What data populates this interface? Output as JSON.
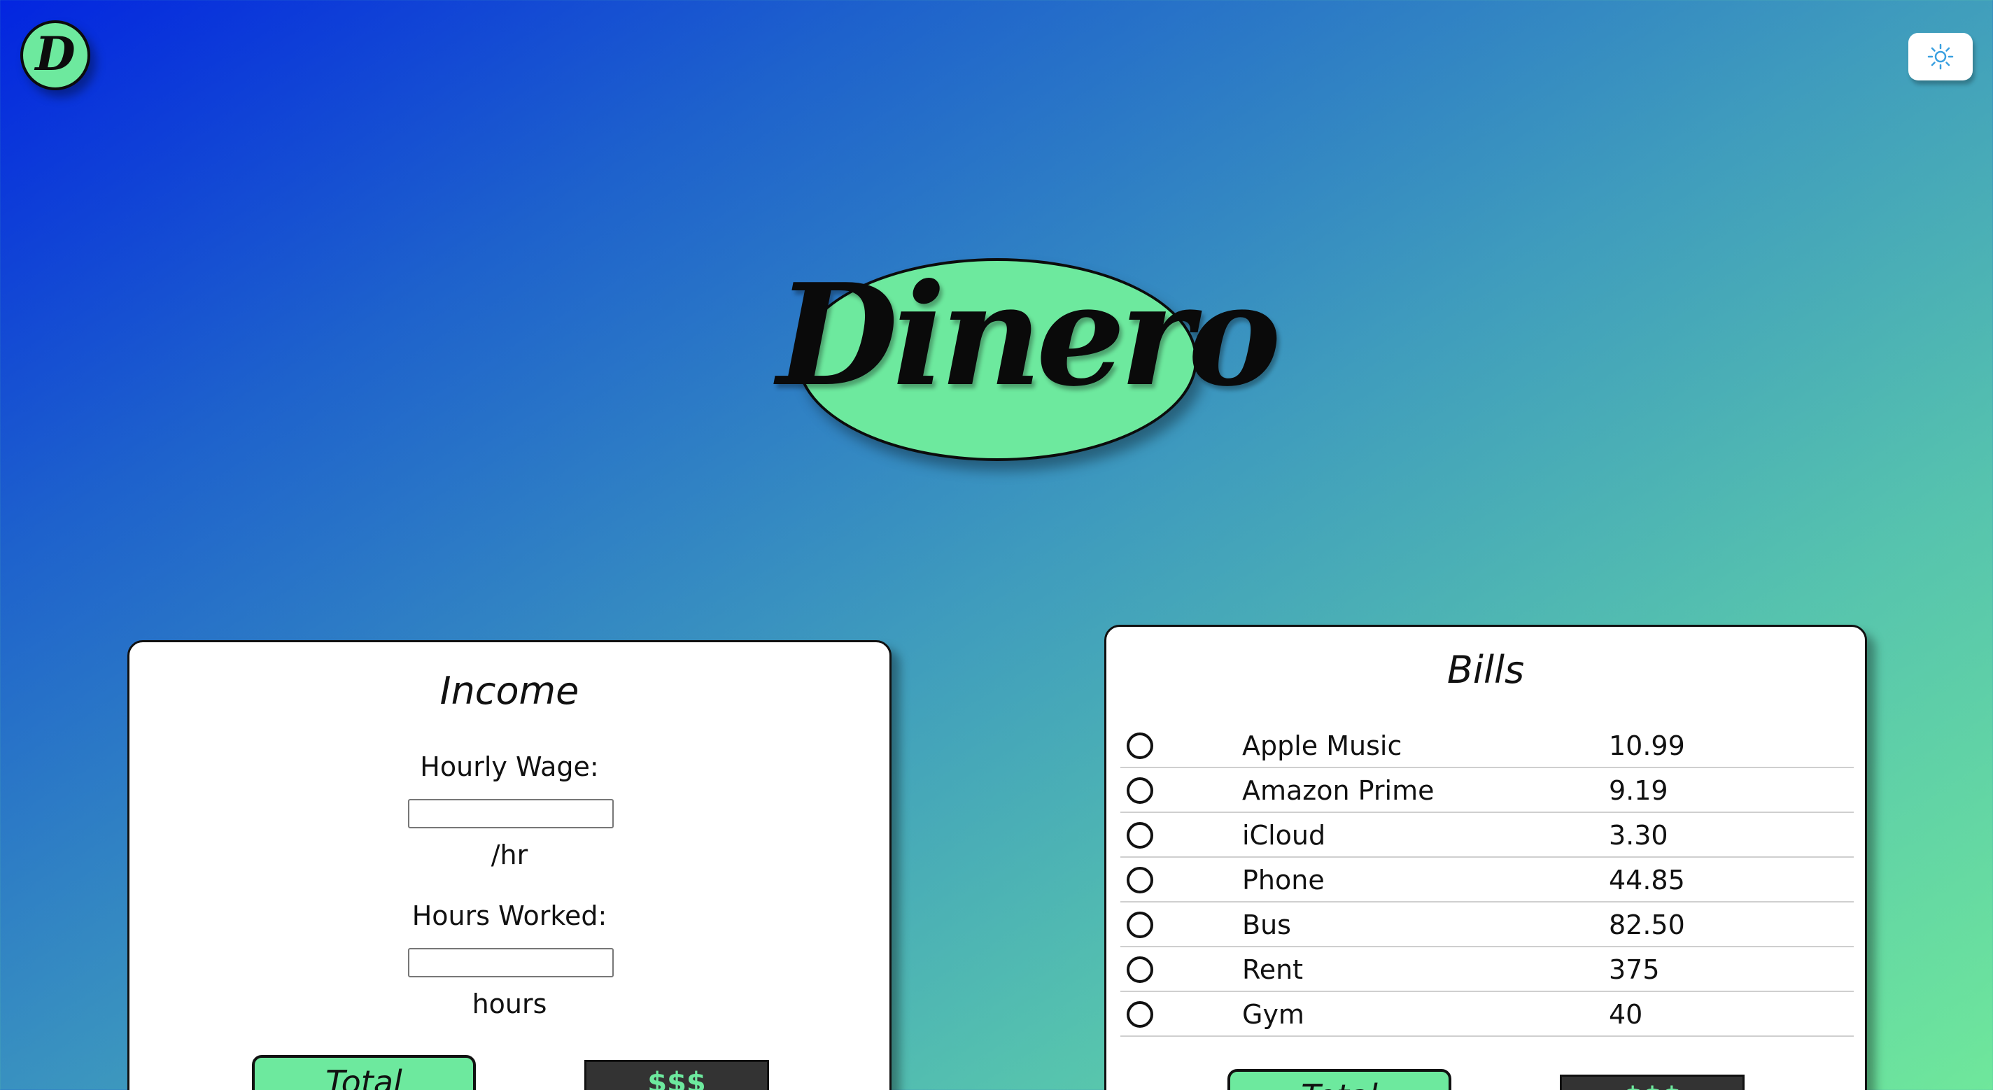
{
  "app": {
    "corner_logo_letter": "D",
    "title": "Dinero",
    "theme_toggle_icon": "sun-icon"
  },
  "colors": {
    "accent_green": "#6de99e",
    "background_start": "#0325e0",
    "background_end": "#6fe79b",
    "dark_box": "#333333"
  },
  "income": {
    "title": "Income",
    "hourly_wage_label": "Hourly Wage:",
    "hourly_wage_value": "",
    "hourly_unit": "/hr",
    "hours_worked_label": "Hours Worked:",
    "hours_worked_value": "",
    "hours_unit": "hours",
    "total_label": "Total",
    "result": "$$$"
  },
  "bills": {
    "title": "Bills",
    "items": [
      {
        "name": "Apple Music",
        "amount": "10.99"
      },
      {
        "name": "Amazon Prime",
        "amount": "9.19"
      },
      {
        "name": "iCloud",
        "amount": "3.30"
      },
      {
        "name": "Phone",
        "amount": "44.85"
      },
      {
        "name": "Bus",
        "amount": "82.50"
      },
      {
        "name": "Rent",
        "amount": "375"
      },
      {
        "name": "Gym",
        "amount": "40"
      }
    ],
    "total_label": "Total",
    "result": "$$$"
  }
}
